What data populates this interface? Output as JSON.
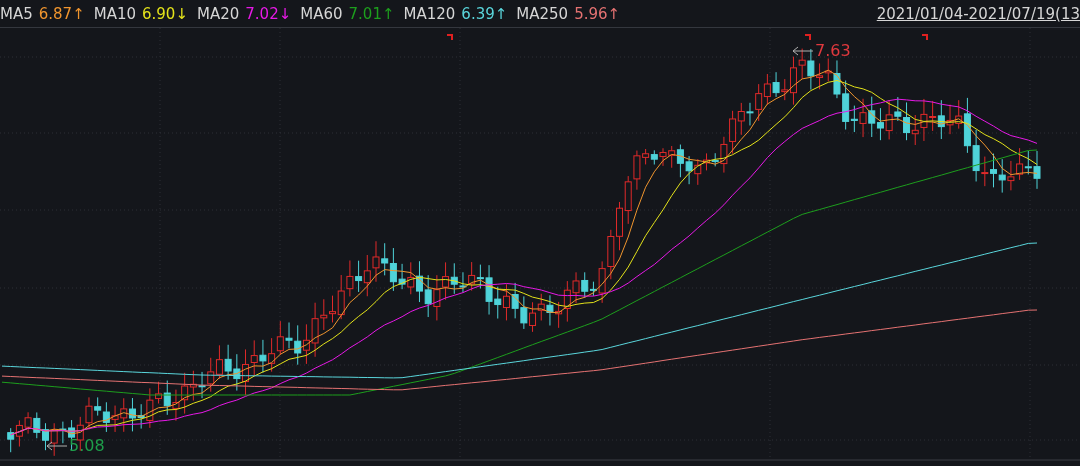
{
  "legend": [
    {
      "label": "MA5",
      "value": "6.87↑",
      "color": "#f0952e"
    },
    {
      "label": "MA10",
      "value": "6.90↓",
      "color": "#e3e21a"
    },
    {
      "label": "MA20",
      "value": "7.02↓",
      "color": "#e619e6"
    },
    {
      "label": "MA60",
      "value": "7.01↑",
      "color": "#1d9e1d"
    },
    {
      "label": "MA120",
      "value": "6.39↑",
      "color": "#5ad6dc"
    },
    {
      "label": "MA250",
      "value": "5.96↑",
      "color": "#e57272"
    }
  ],
  "date_range": "2021/01/04-2021/07/19(13",
  "high_label": {
    "text": "7.63",
    "color": "#e0393e"
  },
  "low_label": {
    "text": "5.08",
    "color": "#1e9e4a"
  }
}
